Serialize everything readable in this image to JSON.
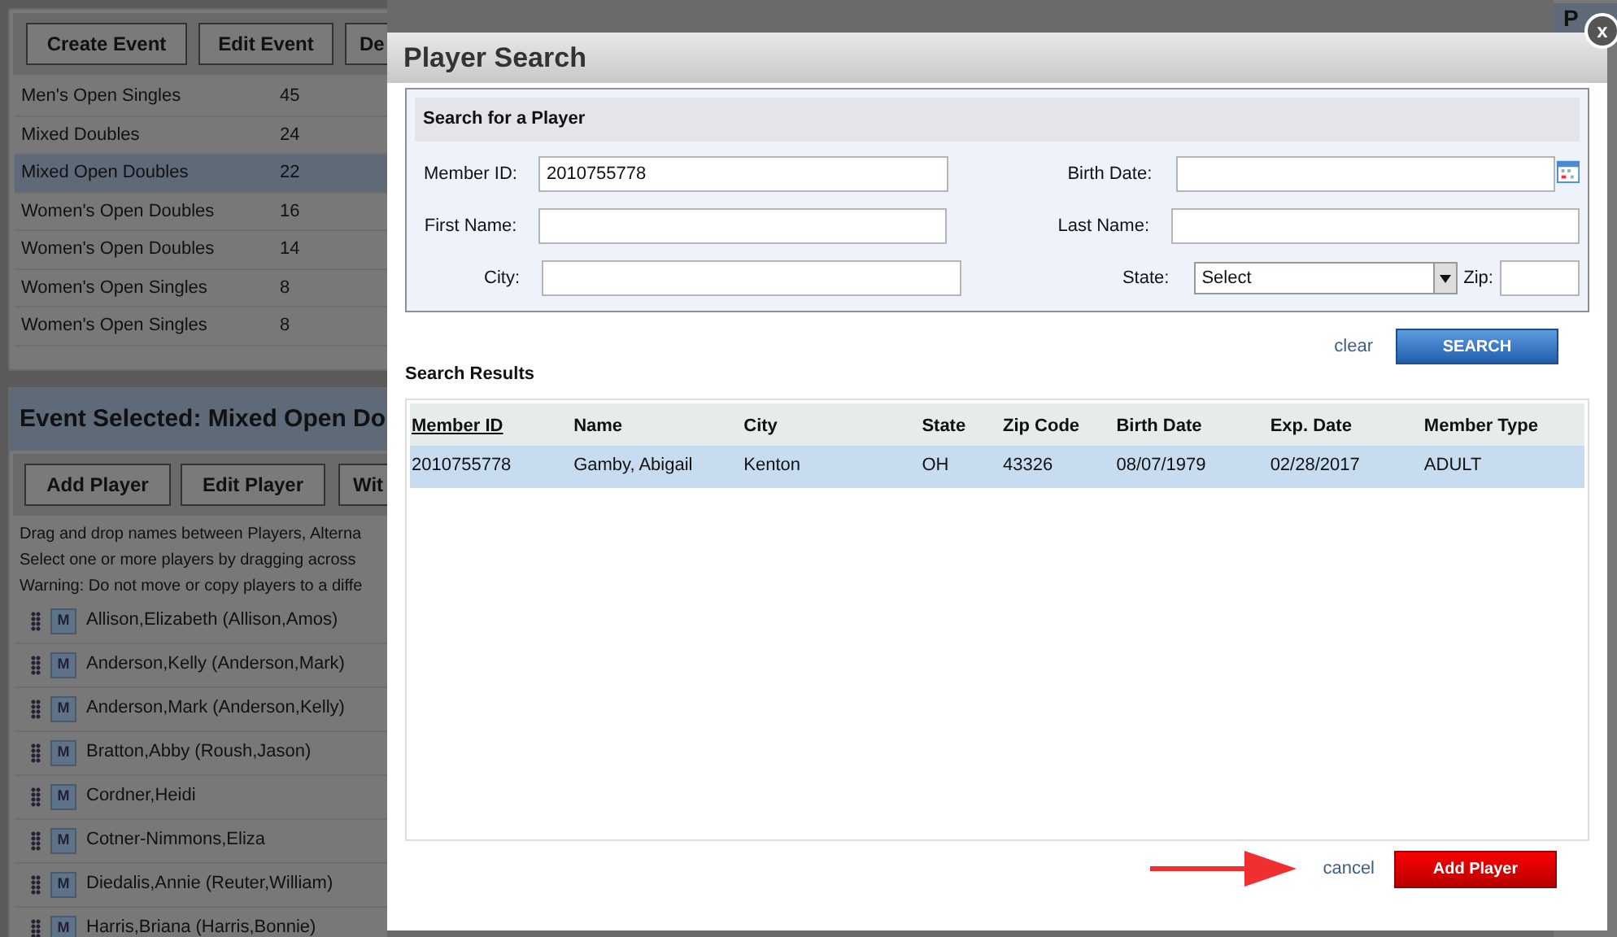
{
  "background": {
    "toolbar": [
      "Create Event",
      "Edit Event",
      "De"
    ],
    "events": [
      {
        "name": "Men's Open Singles",
        "count": "45",
        "selected": false
      },
      {
        "name": "Mixed Doubles",
        "count": "24",
        "selected": false
      },
      {
        "name": "Mixed Open Doubles",
        "count": "22",
        "selected": true
      },
      {
        "name": "Women's Open Doubles",
        "count": "16",
        "selected": false
      },
      {
        "name": "Women's Open Doubles",
        "count": "14",
        "selected": false
      },
      {
        "name": "Women's Open Singles",
        "count": "8",
        "selected": false
      },
      {
        "name": "Women's Open Singles",
        "count": "8",
        "selected": false
      }
    ],
    "event_header": "Event Selected: Mixed Open Do",
    "player_buttons": [
      "Add Player",
      "Edit Player",
      "Wit"
    ],
    "instructions": [
      "Drag and drop names between Players, Alterna",
      "Select one or more players by dragging across",
      "Warning: Do not move or copy players to a diffe"
    ],
    "players": [
      {
        "badge": "M",
        "name": "Allison,Elizabeth (Allison,Amos)"
      },
      {
        "badge": "M",
        "name": "Anderson,Kelly (Anderson,Mark)"
      },
      {
        "badge": "M",
        "name": "Anderson,Mark (Anderson,Kelly)"
      },
      {
        "badge": "M",
        "name": "Bratton,Abby (Roush,Jason)"
      },
      {
        "badge": "M",
        "name": "Cordner,Heidi"
      },
      {
        "badge": "M",
        "name": "Cotner-Nimmons,Eliza"
      },
      {
        "badge": "M",
        "name": "Diedalis,Annie (Reuter,William)"
      },
      {
        "badge": "M",
        "name": "Harris,Briana (Harris,Bonnie)"
      }
    ],
    "right_header": "P"
  },
  "dialog": {
    "title": "Player Search",
    "close": "x",
    "search_panel": {
      "title": "Search for a Player",
      "rows": [
        [
          {
            "label": "Member ID:",
            "value": "2010755778",
            "kind": "text"
          },
          {
            "label": "Birth Date:",
            "kind": "date"
          }
        ],
        [
          {
            "label": "First Name:",
            "kind": "text"
          },
          {
            "label": "Last Name:",
            "kind": "text"
          }
        ],
        [
          {
            "label": "City:",
            "kind": "text"
          },
          {
            "label": "State:",
            "value": "Select",
            "kind": "select"
          },
          {
            "label": "Zip:",
            "kind": "zip"
          }
        ]
      ]
    },
    "clear_link": "clear",
    "search_button": "SEARCH",
    "results_title": "Search Results",
    "columns": [
      {
        "label": "Member ID",
        "sorted": true
      },
      {
        "label": "Name",
        "sorted": false
      },
      {
        "label": "City",
        "sorted": false
      },
      {
        "label": "State",
        "sorted": false
      },
      {
        "label": "Zip Code",
        "sorted": false
      },
      {
        "label": "Birth Date",
        "sorted": false
      },
      {
        "label": "Exp. Date",
        "sorted": false
      },
      {
        "label": "Member Type",
        "sorted": false
      }
    ],
    "rows": [
      {
        "cells": [
          "2010755778",
          "Gamby, Abigail",
          "Kenton",
          "OH",
          "43326",
          "08/07/1979",
          "02/28/2017",
          "ADULT"
        ],
        "selected": true
      }
    ],
    "cancel_link": "cancel",
    "add_button": "Add Player"
  }
}
